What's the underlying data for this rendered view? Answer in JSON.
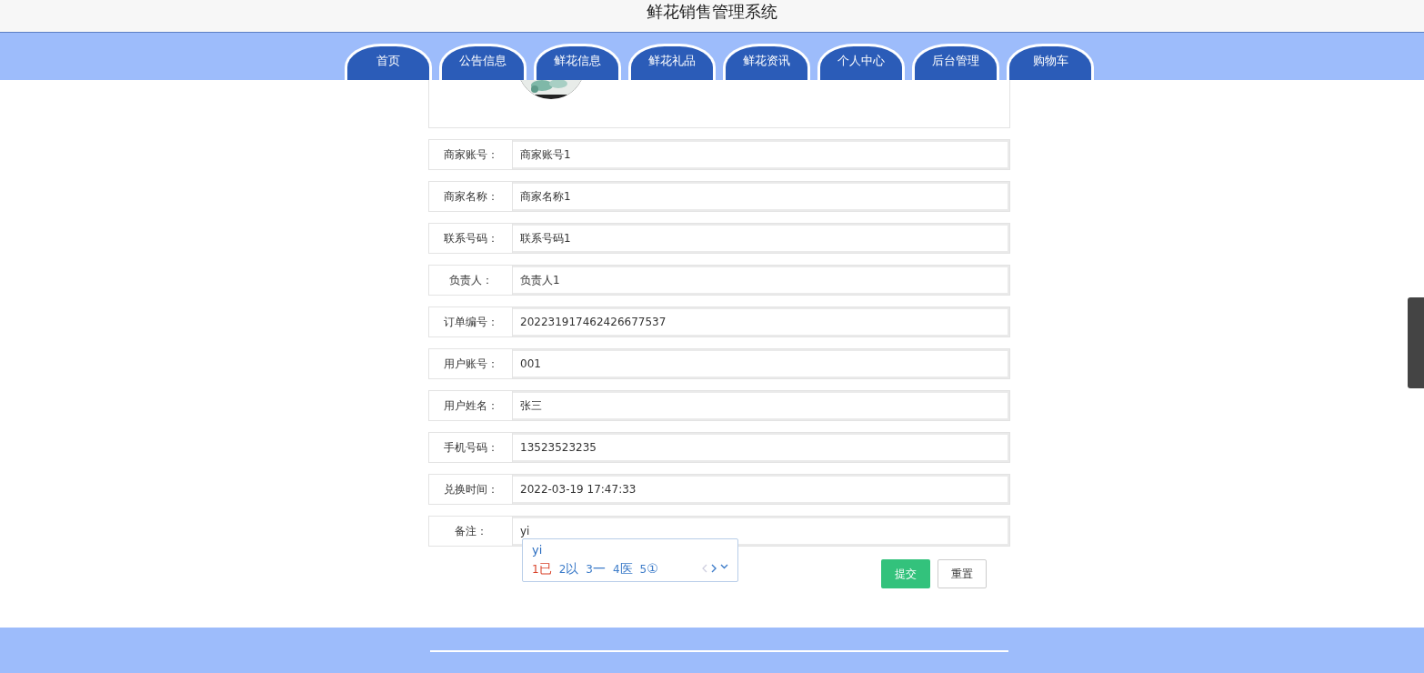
{
  "header": {
    "title": "鲜花销售管理系统"
  },
  "nav": [
    {
      "label": "首页",
      "selected": false
    },
    {
      "label": "公告信息",
      "selected": false
    },
    {
      "label": "鲜花信息",
      "selected": false
    },
    {
      "label": "鲜花礼品",
      "selected": false
    },
    {
      "label": "鲜花资讯",
      "selected": false
    },
    {
      "label": "个人中心",
      "selected": false
    },
    {
      "label": "后台管理",
      "selected": false
    },
    {
      "label": "购物车",
      "selected": false
    }
  ],
  "form": {
    "fields": [
      {
        "label": "商家账号：",
        "value": "商家账号1"
      },
      {
        "label": "商家名称：",
        "value": "商家名称1"
      },
      {
        "label": "联系号码：",
        "value": "联系号码1"
      },
      {
        "label": "负责人：",
        "value": "负责人1"
      },
      {
        "label": "订单编号：",
        "value": "202231917462426677537"
      },
      {
        "label": "用户账号：",
        "value": "001"
      },
      {
        "label": "用户姓名：",
        "value": "张三"
      },
      {
        "label": "手机号码：",
        "value": "13523523235"
      },
      {
        "label": "兑换时间：",
        "value": "2022-03-19 17:47:33"
      },
      {
        "label": "备注：",
        "value": "yi"
      }
    ],
    "buttons": [
      {
        "label": "提交",
        "kind": "primary"
      },
      {
        "label": "重置",
        "kind": "secondary"
      }
    ]
  },
  "ime": {
    "composition": "yi",
    "candidates": [
      {
        "number": "1",
        "text": "已",
        "selected": true
      },
      {
        "number": "2",
        "text": "以",
        "selected": false
      },
      {
        "number": "3",
        "text": "一",
        "selected": false
      },
      {
        "number": "4",
        "text": "医",
        "selected": false
      },
      {
        "number": "5",
        "text": "①",
        "selected": false
      }
    ]
  }
}
